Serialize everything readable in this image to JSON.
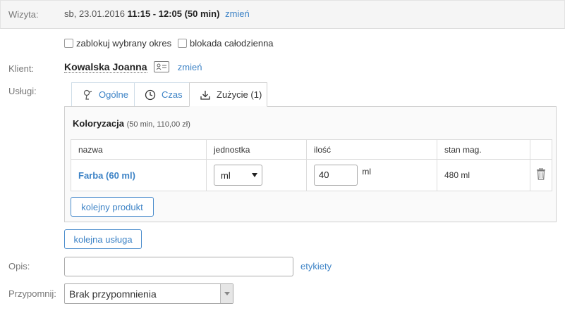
{
  "visit": {
    "label": "Wizyta:",
    "date": "sb, 23.01.2016",
    "time": "11:15 - 12:05 (50 min)",
    "change": "zmień"
  },
  "block": {
    "option1": "zablokuj wybrany okres",
    "option2": "blokada całodzienna"
  },
  "client": {
    "label": "Klient:",
    "name": "Kowalska Joanna",
    "change": "zmień"
  },
  "services": {
    "label": "Usługi:",
    "tabs": [
      {
        "label": "Ogólne",
        "icon": "hair-dryer-icon"
      },
      {
        "label": "Czas",
        "icon": "clock-icon"
      },
      {
        "label": "Zużycie (1)",
        "icon": "download-icon"
      }
    ],
    "active_tab": 2,
    "service_name": "Koloryzacja",
    "service_details": "(50 min, 110,00 zł)",
    "table": {
      "headers": [
        "nazwa",
        "jednostka",
        "ilość",
        "stan mag."
      ],
      "rows": [
        {
          "name": "Farba (60 ml)",
          "unit": "ml",
          "quantity": "40",
          "quantity_unit": "ml",
          "stock": "480 ml"
        }
      ]
    },
    "add_product": "kolejny produkt",
    "add_service": "kolejna usługa"
  },
  "description": {
    "label": "Opis:",
    "value": "",
    "tags_link": "etykiety"
  },
  "reminder": {
    "label": "Przypomnij:",
    "selected": "Brak przypomnienia"
  },
  "colors": {
    "accent": "#3d83c6",
    "border": "#cfcfcf"
  }
}
